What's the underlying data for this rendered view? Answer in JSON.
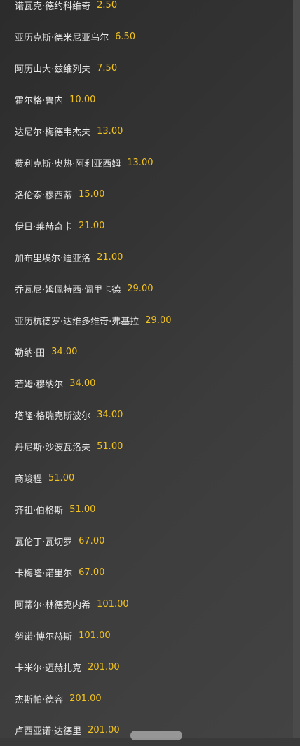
{
  "odds_list": [
    {
      "name": "诺瓦克·德约科维奇",
      "odds": "2.50"
    },
    {
      "name": "亚历克斯·德米尼亚乌尔",
      "odds": "6.50"
    },
    {
      "name": "阿历山大·兹维列夫",
      "odds": "7.50"
    },
    {
      "name": "霍尔格·鲁内",
      "odds": "10.00"
    },
    {
      "name": "达尼尔·梅德韦杰夫",
      "odds": "13.00"
    },
    {
      "name": "费利克斯·奥热·阿利亚西姆",
      "odds": "13.00"
    },
    {
      "name": "洛伦索·穆西蒂",
      "odds": "15.00"
    },
    {
      "name": "伊日·莱赫奇卡",
      "odds": "21.00"
    },
    {
      "name": "加布里埃尔·迪亚洛",
      "odds": "21.00"
    },
    {
      "name": "乔瓦尼·姆佩特西·佩里卡德",
      "odds": "29.00"
    },
    {
      "name": "亚历杭德罗·达维多维奇·弗基拉",
      "odds": "29.00"
    },
    {
      "name": "勒纳·田",
      "odds": "34.00"
    },
    {
      "name": "若姆·穆纳尔",
      "odds": "34.00"
    },
    {
      "name": "塔隆·格瑞克斯波尔",
      "odds": "34.00"
    },
    {
      "name": "丹尼斯·沙波瓦洛夫",
      "odds": "51.00"
    },
    {
      "name": "商竣程",
      "odds": "51.00"
    },
    {
      "name": "齐祖·伯格斯",
      "odds": "51.00"
    },
    {
      "name": "瓦伦丁·瓦切罗",
      "odds": "67.00"
    },
    {
      "name": "卡梅隆·诺里尔",
      "odds": "67.00"
    },
    {
      "name": "阿蒂尔·林德克内希",
      "odds": "101.00"
    },
    {
      "name": "努诺·博尔赫斯",
      "odds": "101.00"
    },
    {
      "name": "卡米尔·迈赫扎克",
      "odds": "201.00"
    },
    {
      "name": "杰斯帕·德容",
      "odds": "201.00"
    },
    {
      "name": "卢西亚诺·达德里",
      "odds": "201.00"
    }
  ]
}
